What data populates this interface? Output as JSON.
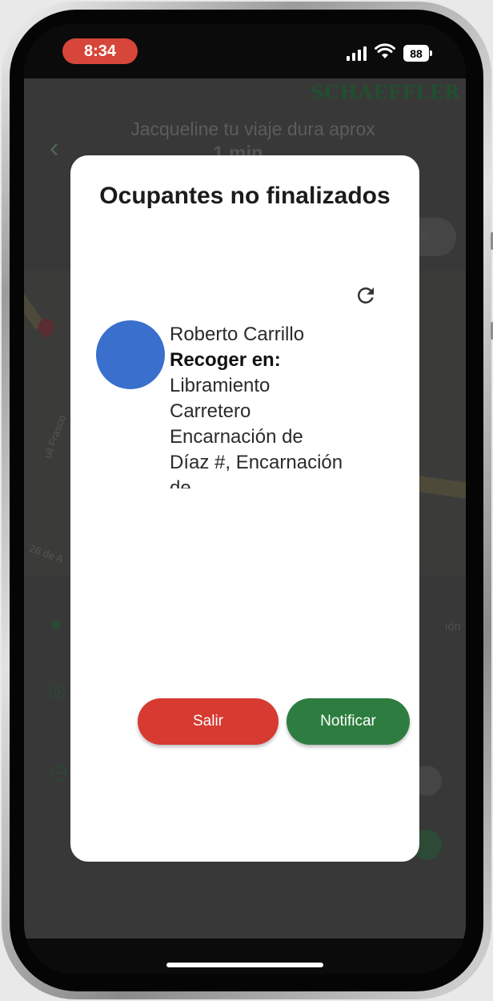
{
  "status_bar": {
    "time": "8:34",
    "battery": "88",
    "time_pill_color": "#d6463a"
  },
  "background_app": {
    "brand": "SCHAEFFLER",
    "trip_text": "Jacqueline tu viaje dura aprox",
    "trip_duration_partial": "1 min",
    "map_streets": [
      "uil Frasco",
      "26 de A"
    ],
    "side_label_partial": "ión",
    "chip_partial": "ar",
    "icons": [
      "back-arrow-icon",
      "location-pin-icon",
      "target-icon",
      "clock-icon"
    ]
  },
  "modal": {
    "title": "Ocupantes no finalizados",
    "refresh_icon": "refresh-icon",
    "occupant": {
      "name": "Roberto Carrillo",
      "pickup_label": "Recoger en:",
      "address": "Libramiento Carretero Encarnación de Díaz #, Encarnación de",
      "avatar_color": "#3a6fcd"
    },
    "buttons": {
      "exit": "Salir",
      "notify": "Notificar"
    }
  },
  "colors": {
    "exit": "#d63a31",
    "notify": "#2e7d40",
    "brand": "#21502f"
  }
}
